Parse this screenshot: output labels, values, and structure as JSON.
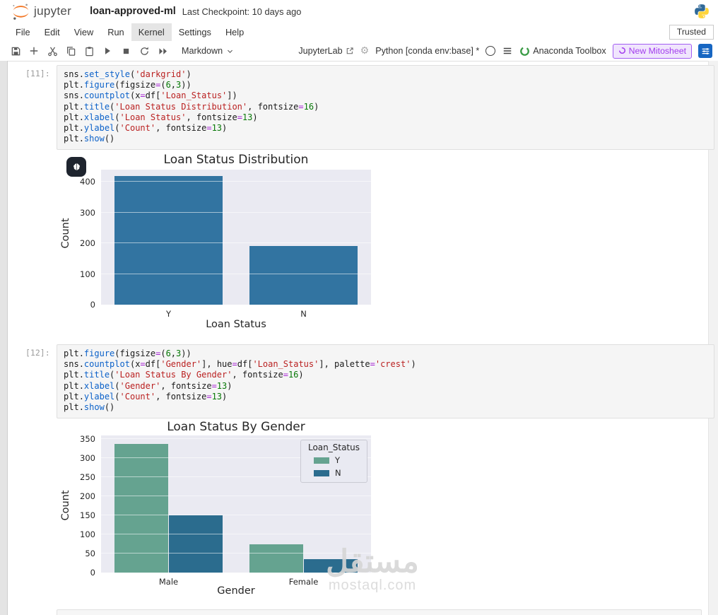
{
  "titlebar": {
    "logo_text": "jupyter",
    "title": "loan-approved-ml",
    "checkpoint": "Last Checkpoint: 10 days ago"
  },
  "menubar": {
    "items": [
      "File",
      "Edit",
      "View",
      "Run",
      "Kernel",
      "Settings",
      "Help"
    ],
    "active_item": "Kernel",
    "trusted_label": "Trusted"
  },
  "toolbar": {
    "cell_type_selector": "Markdown",
    "jupyterlab_link": "JupyterLab",
    "kernel_label": "Python [conda env:base] *",
    "anaconda_label": "Anaconda Toolbox",
    "mitosheet_label": "New Mitosheet"
  },
  "cells": [
    {
      "prompt": "[11]:",
      "lines": [
        [
          [
            "n",
            "sns"
          ],
          [
            "p",
            "."
          ],
          [
            "f",
            "set_style"
          ],
          [
            "p",
            "("
          ],
          [
            "s",
            "'darkgrid'"
          ],
          [
            "p",
            ")"
          ]
        ],
        [
          [
            "n",
            "plt"
          ],
          [
            "p",
            "."
          ],
          [
            "f",
            "figure"
          ],
          [
            "p",
            "("
          ],
          [
            "n",
            "figsize"
          ],
          [
            "o",
            "="
          ],
          [
            "p",
            "("
          ],
          [
            "d",
            "6"
          ],
          [
            "p",
            ","
          ],
          [
            "d",
            "3"
          ],
          [
            "p",
            "))"
          ]
        ],
        [
          [
            "n",
            "sns"
          ],
          [
            "p",
            "."
          ],
          [
            "f",
            "countplot"
          ],
          [
            "p",
            "("
          ],
          [
            "n",
            "x"
          ],
          [
            "o",
            "="
          ],
          [
            "n",
            "df"
          ],
          [
            "p",
            "["
          ],
          [
            "s",
            "'Loan_Status'"
          ],
          [
            "p",
            "])"
          ]
        ],
        [
          [
            "n",
            "plt"
          ],
          [
            "p",
            "."
          ],
          [
            "f",
            "title"
          ],
          [
            "p",
            "("
          ],
          [
            "s",
            "'Loan Status Distribution'"
          ],
          [
            "p",
            ", "
          ],
          [
            "n",
            "fontsize"
          ],
          [
            "o",
            "="
          ],
          [
            "d",
            "16"
          ],
          [
            "p",
            ")"
          ]
        ],
        [
          [
            "n",
            "plt"
          ],
          [
            "p",
            "."
          ],
          [
            "f",
            "xlabel"
          ],
          [
            "p",
            "("
          ],
          [
            "s",
            "'Loan Status'"
          ],
          [
            "p",
            ", "
          ],
          [
            "n",
            "fontsize"
          ],
          [
            "o",
            "="
          ],
          [
            "d",
            "13"
          ],
          [
            "p",
            ")"
          ]
        ],
        [
          [
            "n",
            "plt"
          ],
          [
            "p",
            "."
          ],
          [
            "f",
            "ylabel"
          ],
          [
            "p",
            "("
          ],
          [
            "s",
            "'Count'"
          ],
          [
            "p",
            ", "
          ],
          [
            "n",
            "fontsize"
          ],
          [
            "o",
            "="
          ],
          [
            "d",
            "13"
          ],
          [
            "p",
            ")"
          ]
        ],
        [
          [
            "n",
            "plt"
          ],
          [
            "p",
            "."
          ],
          [
            "f",
            "show"
          ],
          [
            "p",
            "()"
          ]
        ]
      ]
    },
    {
      "prompt": "[12]:",
      "lines": [
        [
          [
            "n",
            "plt"
          ],
          [
            "p",
            "."
          ],
          [
            "f",
            "figure"
          ],
          [
            "p",
            "("
          ],
          [
            "n",
            "figsize"
          ],
          [
            "o",
            "="
          ],
          [
            "p",
            "("
          ],
          [
            "d",
            "6"
          ],
          [
            "p",
            ","
          ],
          [
            "d",
            "3"
          ],
          [
            "p",
            "))"
          ]
        ],
        [
          [
            "n",
            "sns"
          ],
          [
            "p",
            "."
          ],
          [
            "f",
            "countplot"
          ],
          [
            "p",
            "("
          ],
          [
            "n",
            "x"
          ],
          [
            "o",
            "="
          ],
          [
            "n",
            "df"
          ],
          [
            "p",
            "["
          ],
          [
            "s",
            "'Gender'"
          ],
          [
            "p",
            "], "
          ],
          [
            "n",
            "hue"
          ],
          [
            "o",
            "="
          ],
          [
            "n",
            "df"
          ],
          [
            "p",
            "["
          ],
          [
            "s",
            "'Loan_Status'"
          ],
          [
            "p",
            "], "
          ],
          [
            "n",
            "palette"
          ],
          [
            "o",
            "="
          ],
          [
            "s",
            "'crest'"
          ],
          [
            "p",
            ")"
          ]
        ],
        [
          [
            "n",
            "plt"
          ],
          [
            "p",
            "."
          ],
          [
            "f",
            "title"
          ],
          [
            "p",
            "("
          ],
          [
            "s",
            "'Loan Status By Gender'"
          ],
          [
            "p",
            ", "
          ],
          [
            "n",
            "fontsize"
          ],
          [
            "o",
            "="
          ],
          [
            "d",
            "16"
          ],
          [
            "p",
            ")"
          ]
        ],
        [
          [
            "n",
            "plt"
          ],
          [
            "p",
            "."
          ],
          [
            "f",
            "xlabel"
          ],
          [
            "p",
            "("
          ],
          [
            "s",
            "'Gender'"
          ],
          [
            "p",
            ", "
          ],
          [
            "n",
            "fontsize"
          ],
          [
            "o",
            "="
          ],
          [
            "d",
            "13"
          ],
          [
            "p",
            ")"
          ]
        ],
        [
          [
            "n",
            "plt"
          ],
          [
            "p",
            "."
          ],
          [
            "f",
            "ylabel"
          ],
          [
            "p",
            "("
          ],
          [
            "s",
            "'Count'"
          ],
          [
            "p",
            ", "
          ],
          [
            "n",
            "fontsize"
          ],
          [
            "o",
            "="
          ],
          [
            "d",
            "13"
          ],
          [
            "p",
            ")"
          ]
        ],
        [
          [
            "n",
            "plt"
          ],
          [
            "p",
            "."
          ],
          [
            "f",
            "show"
          ],
          [
            "p",
            "()"
          ]
        ]
      ]
    }
  ],
  "chart_data": [
    {
      "type": "bar",
      "title": "Loan Status Distribution",
      "categories": [
        "Y",
        "N"
      ],
      "values": [
        420,
        192
      ],
      "bar_color": "#3274a1",
      "xlabel": "Loan Status",
      "ylabel": "Count",
      "ylim": [
        0,
        440
      ],
      "yticks": [
        0,
        100,
        200,
        300,
        400
      ],
      "grid": true,
      "style": "seaborn-darkgrid",
      "plot_bg": "#eaeaf2"
    },
    {
      "type": "bar",
      "title": "Loan Status By Gender",
      "categories": [
        "Male",
        "Female"
      ],
      "series": [
        {
          "name": "Y",
          "color": "#65a390",
          "values": [
            338,
            75
          ]
        },
        {
          "name": "N",
          "color": "#2b6c8e",
          "values": [
            150,
            35
          ]
        }
      ],
      "legend_title": "Loan_Status",
      "legend_position": "upper right",
      "xlabel": "Gender",
      "ylabel": "Count",
      "ylim": [
        0,
        360
      ],
      "yticks": [
        0,
        50,
        100,
        150,
        200,
        250,
        300,
        350
      ],
      "grid": true,
      "style": "seaborn-darkgrid",
      "plot_bg": "#eaeaf2",
      "palette": "crest"
    }
  ],
  "watermark": {
    "arabic": "مستقل",
    "site": "mostaql.com"
  },
  "colors": {
    "jupyter_orange": "#f37726",
    "python_blue": "#306998",
    "python_yellow": "#ffd43b",
    "anaconda_green": "#3eb049",
    "mito_purple": "#a23bee",
    "sliders_blue": "#1766c2",
    "bar_blue": "#3274a1",
    "crest_y": "#65a390",
    "crest_n": "#2b6c8e"
  }
}
